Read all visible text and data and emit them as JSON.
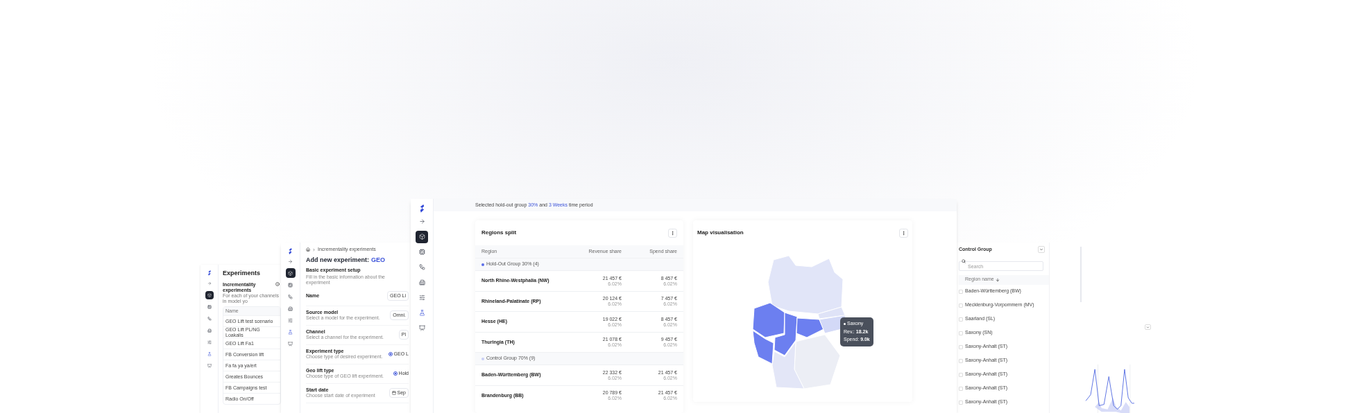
{
  "experiments_window": {
    "nav": [
      {
        "selected": false
      },
      {
        "selected": true
      },
      {
        "selected": false
      },
      {
        "selected": false
      },
      {
        "selected": false
      },
      {
        "selected": false
      },
      {
        "selected": false
      },
      {
        "selected": false
      }
    ],
    "title": "Experiments",
    "section": "Incrementality experiments",
    "description": "For each of your channels in model yo",
    "table": {
      "columns": [
        "Name"
      ],
      "rows": [
        "GEO Lift test scenario",
        "GEO Lift PL/NG Loakalis",
        "GEO Lift Fa1",
        "FB Conversion lift",
        "Fa fa ya ya/ert",
        "Greates Bounces",
        "FB Campaigns test",
        "Radio On/Off"
      ]
    }
  },
  "new_experiment_window": {
    "nav": [
      {
        "selected": false
      },
      {
        "selected": true
      },
      {
        "selected": false
      },
      {
        "selected": false
      },
      {
        "selected": false
      },
      {
        "selected": false
      },
      {
        "selected": false
      },
      {
        "selected": false
      }
    ],
    "breadcrumb": "Incrementality experiments",
    "title": "Add new experiment:",
    "title_highlight": "GEO",
    "section": "Basic experiment setup",
    "description": "Fill in the basic information about the experiment",
    "fields": [
      {
        "kind": "text",
        "label": "Name",
        "value": "GEO Li"
      },
      {
        "kind": "text",
        "label": "Source model",
        "description": "Select a model for the experiment.",
        "value": "Omni."
      },
      {
        "kind": "text",
        "label": "Channel",
        "description": "Select a channel for the experiment.",
        "value": "Pl"
      },
      {
        "kind": "radio",
        "label": "Experiment type",
        "description": "Choose type of desired experiment.",
        "value": "GEO L",
        "selected": true
      },
      {
        "kind": "radio",
        "label": "Geo lift type",
        "description": "Choose type of GEO lift experiment.",
        "value": "Hold",
        "selected": true
      },
      {
        "kind": "date",
        "label": "Start date",
        "description": "Choose start date of experiment",
        "value": "Sep"
      }
    ]
  },
  "main_window": {
    "nav": [
      {
        "selected": false
      },
      {
        "selected": true
      },
      {
        "selected": false
      },
      {
        "selected": false
      },
      {
        "selected": false
      },
      {
        "selected": false
      },
      {
        "selected": false
      },
      {
        "selected": false
      }
    ],
    "banner": "Selected hold-out group **30%** and **3 Weeks** time period",
    "regions_split": {
      "title": "Regions split",
      "columns": [
        "Region",
        "Revenue share",
        "Spend share"
      ],
      "groups": [
        {
          "label": "Hold-Out Group 30% (4)",
          "color": "#5b6ee8",
          "rows": [
            {
              "region": "North Rhine-Westphalia (NW)",
              "revenue": "21 457 €",
              "revenue_pct": "6.02%",
              "spend": "8 457 €",
              "spend_pct": "6.02%"
            },
            {
              "region": "Rhineland-Palatinate (RP)",
              "revenue": "20 124 €",
              "revenue_pct": "6.02%",
              "spend": "7 457 €",
              "spend_pct": "6.02%"
            },
            {
              "region": "Hesse (HE)",
              "revenue": "19 022 €",
              "revenue_pct": "6.02%",
              "spend": "8 457 €",
              "spend_pct": "6.02%"
            },
            {
              "region": "Thuringia (TH)",
              "revenue": "21 078 €",
              "revenue_pct": "6.02%",
              "spend": "9 457 €",
              "spend_pct": "6.02%"
            }
          ]
        },
        {
          "label": "Control Group 70% (9)",
          "color": "#c9cff5",
          "rows": [
            {
              "region": "Baden-Württemberg (BW)",
              "revenue": "22 332 €",
              "revenue_pct": "6.02%",
              "spend": "21 457 €",
              "spend_pct": "6.02%"
            },
            {
              "region": "Brandenburg (BB)",
              "revenue": "20 789 €",
              "revenue_pct": "6.02%",
              "spend": "21 457 €",
              "spend_pct": "6.02%"
            }
          ]
        }
      ]
    },
    "map": {
      "title": "Map visualisation",
      "tooltip": {
        "region": "Saxony",
        "revenue": "Rev.: **18.2k**",
        "spend": "Spend: **9.0k**"
      }
    }
  },
  "control_panel": {
    "title": "Control Group",
    "search": {
      "placeholder": "Search"
    },
    "column": "Region name",
    "rows": [
      {
        "label": "Baden-Württemberg (BW)",
        "checked": false
      },
      {
        "label": "Mecklenburg-Vorpommern (MV)",
        "checked": false
      },
      {
        "label": "Saarland (SL)",
        "checked": false
      },
      {
        "label": "Saxony (SN)",
        "checked": false
      },
      {
        "label": "Saxony-Anhalt (ST)",
        "checked": false
      },
      {
        "label": "Saxony-Anhalt (ST)",
        "checked": false
      },
      {
        "label": "Saxony-Anhalt (ST)",
        "checked": false
      },
      {
        "label": "Saxony-Anhalt (ST)",
        "checked": false
      },
      {
        "label": "Saxony-Anhalt (ST)",
        "checked": false
      }
    ]
  }
}
